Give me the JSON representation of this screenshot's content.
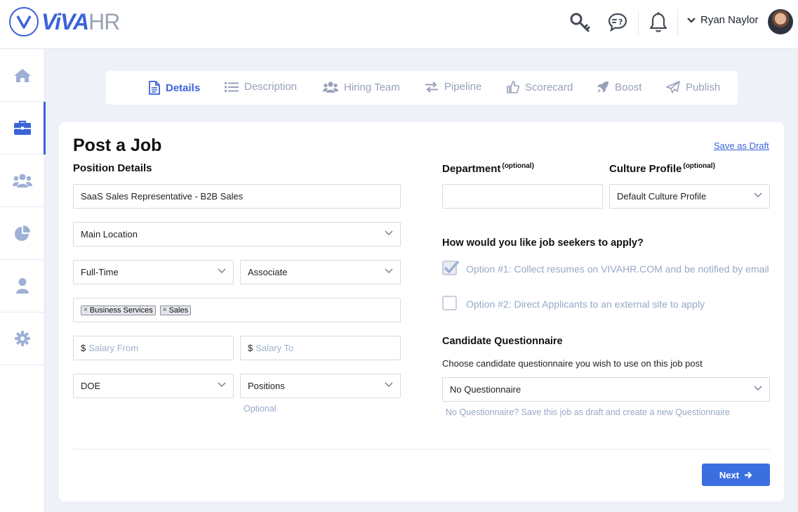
{
  "header": {
    "logo_viva": "ViVA",
    "logo_hr": "HR",
    "user_name": "Ryan Naylor",
    "icons": [
      "key-icon",
      "help-chat-icon",
      "bell-icon",
      "chevron-down-icon"
    ]
  },
  "sidebar": {
    "items": [
      {
        "icon": "home-icon",
        "active": false
      },
      {
        "icon": "briefcase-icon",
        "active": true
      },
      {
        "icon": "team-icon",
        "active": false
      },
      {
        "icon": "pie-chart-icon",
        "active": false
      },
      {
        "icon": "user-icon",
        "active": false
      },
      {
        "icon": "gear-icon",
        "active": false
      }
    ]
  },
  "tabs": [
    {
      "label": "Details",
      "icon": "document-icon",
      "active": true
    },
    {
      "label": "Description",
      "icon": "list-icon",
      "active": false
    },
    {
      "label": "Hiring Team",
      "icon": "team-icon",
      "active": false
    },
    {
      "label": "Pipeline",
      "icon": "exchange-icon",
      "active": false
    },
    {
      "label": "Scorecard",
      "icon": "thumbs-up-icon",
      "active": false
    },
    {
      "label": "Boost",
      "icon": "rocket-icon",
      "active": false
    },
    {
      "label": "Publish",
      "icon": "paper-plane-icon",
      "active": false
    }
  ],
  "page": {
    "title": "Post a Job",
    "save_draft": "Save as Draft"
  },
  "position": {
    "label": "Position Details",
    "job_title": "SaaS Sales Representative - B2B Sales",
    "location": "Main Location",
    "employment_type": "Full-Time",
    "level": "Associate",
    "tags": [
      "Business Services",
      "Sales"
    ],
    "tag_remove": "×",
    "currency": "$",
    "salary_from_placeholder": "Salary From",
    "salary_to_placeholder": "Salary To",
    "pay_basis": "DOE",
    "positions": "Positions",
    "positions_hint": "Optional"
  },
  "department": {
    "label": "Department",
    "optional": "(optional)",
    "value": ""
  },
  "culture": {
    "label": "Culture Profile",
    "optional": "(optional)",
    "value": "Default Culture Profile"
  },
  "apply": {
    "question": "How would you like job seekers to apply?",
    "option1": "Option #1: Collect resumes on VIVAHR.COM and be notified by email",
    "option1_checked": true,
    "option2": "Option #2: Direct Applicants to an external site to apply",
    "option2_checked": false
  },
  "questionnaire": {
    "label": "Candidate Questionnaire",
    "description": "Choose candidate questionnaire you wish to use on this job post",
    "value": "No Questionnaire",
    "hint": "No Questionnaire? Save this job as draft and create a new Questionnaire"
  },
  "footer": {
    "next_label": "Next"
  },
  "colors": {
    "accent": "#3b63d8",
    "button": "#3b6fe0",
    "muted": "#97a1b8"
  }
}
